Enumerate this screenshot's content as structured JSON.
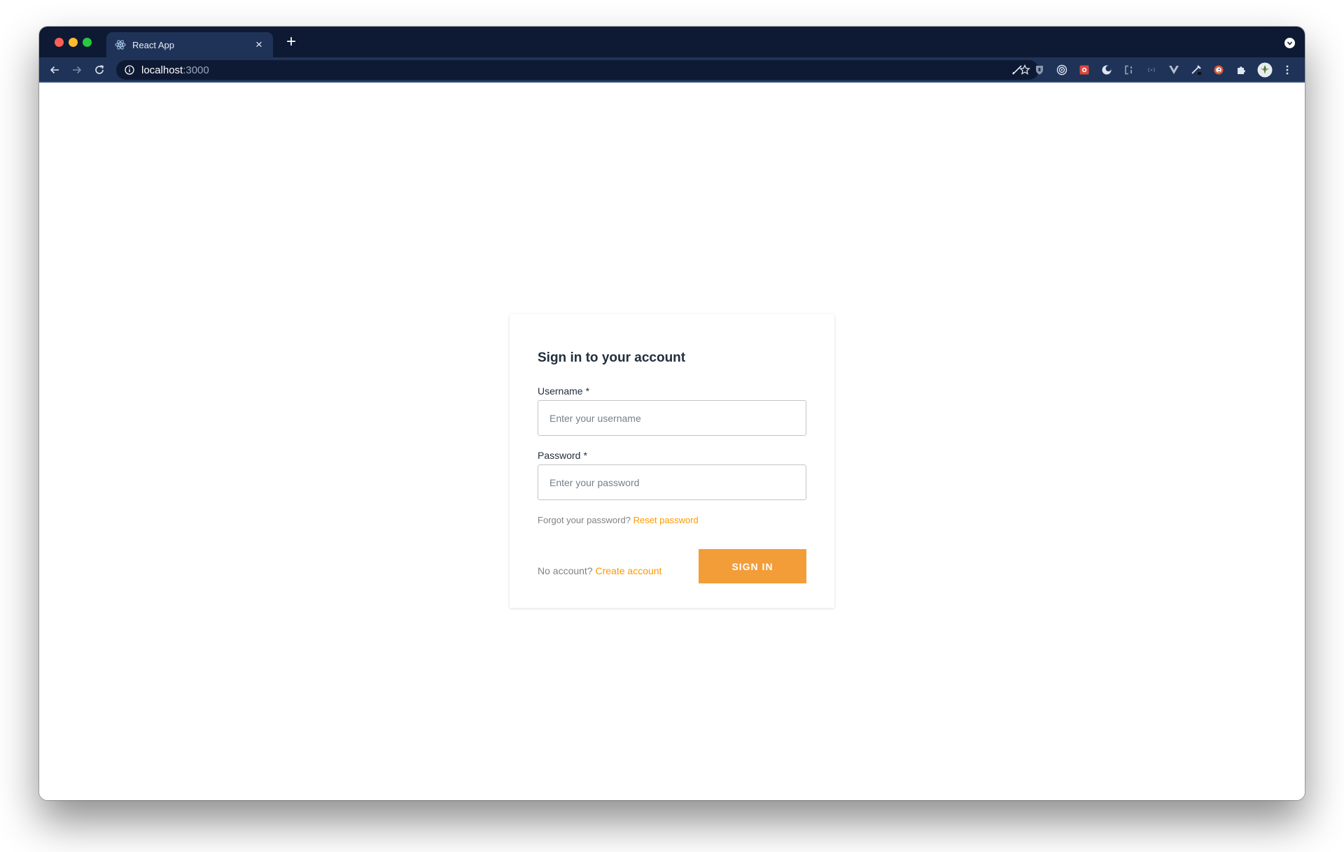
{
  "browser": {
    "tab": {
      "title": "React App",
      "icon": "react-logo-icon"
    },
    "address": {
      "host": "localhost",
      "port": ":3000"
    },
    "new_tab_symbol": "+",
    "close_symbol": "×"
  },
  "signin": {
    "title": "Sign in to your account",
    "username_label": "Username",
    "username_placeholder": "Enter your username",
    "password_label": "Password",
    "password_placeholder": "Enter your password",
    "required_marker": "*",
    "forgot_text": "Forgot your password?",
    "reset_link": "Reset password",
    "no_account_text": "No account?",
    "create_link": "Create account",
    "signin_button": "SIGN IN"
  },
  "colors": {
    "accent": "#f29d38",
    "link": "#ff9900",
    "title_bar": "#0e1a33",
    "toolbar": "#1f3358"
  }
}
